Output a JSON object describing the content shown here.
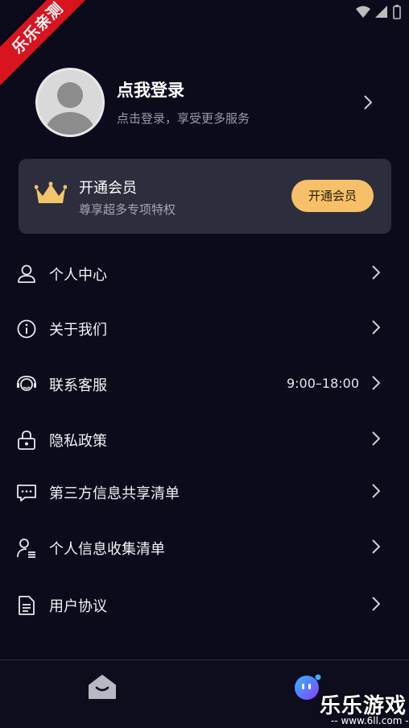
{
  "watermark": {
    "ribbon_text": "乐乐亲测",
    "site_title": "乐乐游戏",
    "site_url": "-- www.6ll.com --"
  },
  "status_bar": {
    "icons": [
      "wifi-icon",
      "signal-icon",
      "battery-icon"
    ]
  },
  "profile": {
    "title": "点我登录",
    "subtitle": "点击登录，享受更多服务"
  },
  "vip": {
    "title": "开通会员",
    "subtitle": "尊享超多专项特权",
    "button": "开通会员"
  },
  "menu": [
    {
      "label": "个人中心",
      "icon": "user-icon",
      "value": ""
    },
    {
      "label": "关于我们",
      "icon": "info-icon",
      "value": ""
    },
    {
      "label": "联系客服",
      "icon": "headset-icon",
      "value": "9:00–18:00"
    },
    {
      "label": "隐私政策",
      "icon": "lock-icon",
      "value": ""
    },
    {
      "label": "第三方信息共享清单",
      "icon": "chat-icon",
      "value": ""
    },
    {
      "label": "个人信息收集清单",
      "icon": "user-list-icon",
      "value": ""
    },
    {
      "label": "用户协议",
      "icon": "document-icon",
      "value": ""
    }
  ],
  "bottom_nav": {
    "items": [
      "home-icon",
      "mine-icon"
    ]
  },
  "colors": {
    "background": "#0b0b1c",
    "card": "#2d2e3d",
    "accent_gold": "#f5c067",
    "ribbon_red": "#d8141f"
  }
}
